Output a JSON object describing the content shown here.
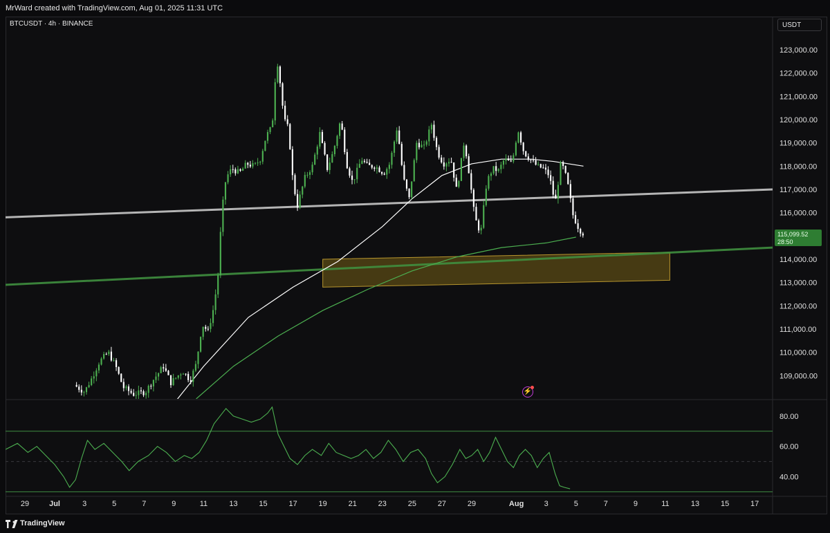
{
  "header": {
    "attribution": "MrWard created with TradingView.com, Aug 01, 2025 11:31 UTC"
  },
  "symbol": {
    "label": "BTCUSDT · 4h · BINANCE"
  },
  "currency": {
    "label": "USDT"
  },
  "last_price": {
    "value": "115,099.52",
    "countdown": "28:50"
  },
  "footer": {
    "brand": "TradingView"
  },
  "colors": {
    "up": "#4caf50",
    "down": "#ffffff",
    "trendline_white": "#c8c8c8",
    "trendline_green": "#3f8f3f",
    "zone_fill": "#5a4a14",
    "zone_border": "#b8962e",
    "rsi": "#4caf50"
  },
  "icons": {
    "indicator": "lightning-bolt-icon",
    "brand": "tradingview-logo-icon"
  },
  "chart_data": [
    {
      "type": "candlestick",
      "title": "BTCUSDT · 4h · BINANCE",
      "ylim": [
        108000,
        123800
      ],
      "y_ticks": [
        109000,
        110000,
        111000,
        112000,
        113000,
        114000,
        115000,
        116000,
        117000,
        118000,
        119000,
        120000,
        121000,
        122000,
        123000
      ],
      "y_tick_labels": [
        "109,000.00",
        "110,000.00",
        "111,000.00",
        "112,000.00",
        "113,000.00",
        "114,000.00",
        "115,000.00",
        "116,000.00",
        "117,000.00",
        "118,000.00",
        "119,000.00",
        "120,000.00",
        "121,000.00",
        "122,000.00",
        "123,000.00"
      ],
      "x_tick_labels": [
        "29",
        "Jul",
        "3",
        "5",
        "7",
        "9",
        "11",
        "13",
        "15",
        "17",
        "19",
        "21",
        "23",
        "25",
        "27",
        "29",
        "Aug",
        "3",
        "5",
        "7",
        "9",
        "11",
        "13",
        "15",
        "17"
      ],
      "x_tick_days": [
        -2,
        0,
        2,
        4,
        6,
        8,
        10,
        12,
        14,
        16,
        18,
        20,
        22,
        24,
        26,
        28,
        31,
        33,
        35,
        37,
        39,
        41,
        43,
        45,
        47
      ],
      "x_range_days": [
        -3.3,
        48.2
      ],
      "close_path": [
        [
          1.3,
          108600
        ],
        [
          2.0,
          108300
        ],
        [
          2.5,
          108900
        ],
        [
          3.0,
          109600
        ],
        [
          3.6,
          110000
        ],
        [
          4.1,
          109400
        ],
        [
          4.6,
          108500
        ],
        [
          5.3,
          108200
        ],
        [
          6.1,
          108300
        ],
        [
          6.6,
          108800
        ],
        [
          7.3,
          109400
        ],
        [
          7.8,
          108700
        ],
        [
          8.6,
          109200
        ],
        [
          9.1,
          108800
        ],
        [
          9.5,
          109500
        ],
        [
          9.9,
          111200
        ],
        [
          10.3,
          110900
        ],
        [
          10.7,
          112000
        ],
        [
          11.0,
          113500
        ],
        [
          11.2,
          115900
        ],
        [
          11.5,
          117500
        ],
        [
          11.9,
          117900
        ],
        [
          12.4,
          117700
        ],
        [
          12.9,
          118100
        ],
        [
          13.4,
          118000
        ],
        [
          13.8,
          118300
        ],
        [
          14.2,
          119300
        ],
        [
          14.6,
          119700
        ],
        [
          14.9,
          122700
        ],
        [
          15.1,
          121800
        ],
        [
          15.4,
          120000
        ],
        [
          15.7,
          119600
        ],
        [
          16.0,
          117300
        ],
        [
          16.3,
          116300
        ],
        [
          16.8,
          117500
        ],
        [
          17.3,
          118000
        ],
        [
          17.8,
          119400
        ],
        [
          18.3,
          117900
        ],
        [
          18.7,
          118600
        ],
        [
          19.2,
          120000
        ],
        [
          19.6,
          118100
        ],
        [
          20.0,
          117300
        ],
        [
          20.6,
          118300
        ],
        [
          21.0,
          118000
        ],
        [
          21.5,
          118000
        ],
        [
          22.1,
          117700
        ],
        [
          22.5,
          118100
        ],
        [
          23.0,
          119700
        ],
        [
          23.4,
          117500
        ],
        [
          23.8,
          116600
        ],
        [
          24.3,
          119000
        ],
        [
          24.8,
          118800
        ],
        [
          25.3,
          119800
        ],
        [
          25.7,
          118600
        ],
        [
          26.1,
          118100
        ],
        [
          26.6,
          118300
        ],
        [
          27.0,
          116900
        ],
        [
          27.5,
          119100
        ],
        [
          27.8,
          117800
        ],
        [
          28.2,
          115800
        ],
        [
          28.6,
          115100
        ],
        [
          29.0,
          117300
        ],
        [
          29.4,
          117900
        ],
        [
          29.8,
          117800
        ],
        [
          30.2,
          118300
        ],
        [
          30.7,
          118100
        ],
        [
          31.1,
          119600
        ],
        [
          31.5,
          118600
        ],
        [
          31.9,
          118300
        ],
        [
          32.4,
          118000
        ],
        [
          32.8,
          117900
        ],
        [
          33.2,
          117600
        ],
        [
          33.6,
          116400
        ],
        [
          34.0,
          118200
        ],
        [
          34.4,
          117400
        ],
        [
          34.8,
          115900
        ],
        [
          35.2,
          115300
        ],
        [
          35.5,
          115100
        ]
      ],
      "overlays": [
        {
          "name": "trendline",
          "color": "#c8c8c8",
          "from": [
            -3.3,
            115800
          ],
          "to": [
            48.2,
            117000
          ]
        },
        {
          "name": "trendline",
          "color": "#3f8f3f",
          "from": [
            -3.3,
            112900
          ],
          "to": [
            48.2,
            114500
          ]
        },
        {
          "name": "ma",
          "color": "#ffffff",
          "points": [
            [
              8.0,
              107800
            ],
            [
              10.0,
              109400
            ],
            [
              13.0,
              111500
            ],
            [
              16.0,
              112800
            ],
            [
              19.0,
              113900
            ],
            [
              22.0,
              115400
            ],
            [
              24.0,
              116600
            ],
            [
              26.0,
              117600
            ],
            [
              28.0,
              118100
            ],
            [
              30.0,
              118300
            ],
            [
              32.0,
              118300
            ],
            [
              33.5,
              118200
            ],
            [
              35.5,
              118000
            ]
          ]
        },
        {
          "name": "ma",
          "color": "#4caf50",
          "points": [
            [
              9.5,
              108000
            ],
            [
              12.0,
              109400
            ],
            [
              15.0,
              110700
            ],
            [
              18.0,
              111800
            ],
            [
              21.0,
              112700
            ],
            [
              24.0,
              113500
            ],
            [
              27.0,
              114100
            ],
            [
              30.0,
              114500
            ],
            [
              33.0,
              114700
            ],
            [
              35.0,
              114950
            ]
          ]
        }
      ],
      "zone": {
        "x": [
          18.0,
          41.3
        ],
        "y": [
          112800,
          114000
        ]
      }
    },
    {
      "type": "line",
      "title": "",
      "ylim": [
        27,
        90
      ],
      "y_ticks": [
        40,
        60,
        80
      ],
      "y_tick_labels": [
        "40.00",
        "60.00",
        "80.00"
      ],
      "bands": [
        30,
        50,
        70
      ],
      "series": [
        {
          "points": [
            [
              -3.3,
              58
            ],
            [
              -2.5,
              62
            ],
            [
              -1.8,
              56
            ],
            [
              -1.2,
              60
            ],
            [
              -0.6,
              54
            ],
            [
              0.0,
              48
            ],
            [
              0.6,
              40
            ],
            [
              1.0,
              33
            ],
            [
              1.4,
              38
            ],
            [
              1.8,
              52
            ],
            [
              2.2,
              64
            ],
            [
              2.7,
              58
            ],
            [
              3.3,
              62
            ],
            [
              3.9,
              56
            ],
            [
              4.5,
              50
            ],
            [
              5.0,
              44
            ],
            [
              5.6,
              50
            ],
            [
              6.3,
              54
            ],
            [
              6.9,
              60
            ],
            [
              7.5,
              56
            ],
            [
              8.1,
              50
            ],
            [
              8.7,
              54
            ],
            [
              9.2,
              52
            ],
            [
              9.7,
              56
            ],
            [
              10.2,
              64
            ],
            [
              10.7,
              75
            ],
            [
              11.1,
              80
            ],
            [
              11.5,
              85
            ],
            [
              12.0,
              80
            ],
            [
              12.6,
              78
            ],
            [
              13.2,
              76
            ],
            [
              13.8,
              78
            ],
            [
              14.3,
              82
            ],
            [
              14.6,
              86
            ],
            [
              15.0,
              68
            ],
            [
              15.4,
              60
            ],
            [
              15.8,
              52
            ],
            [
              16.3,
              48
            ],
            [
              16.8,
              54
            ],
            [
              17.3,
              58
            ],
            [
              17.9,
              54
            ],
            [
              18.4,
              62
            ],
            [
              18.9,
              56
            ],
            [
              19.4,
              54
            ],
            [
              19.9,
              52
            ],
            [
              20.4,
              54
            ],
            [
              20.9,
              58
            ],
            [
              21.4,
              52
            ],
            [
              21.9,
              56
            ],
            [
              22.4,
              64
            ],
            [
              22.9,
              58
            ],
            [
              23.4,
              50
            ],
            [
              23.9,
              56
            ],
            [
              24.4,
              58
            ],
            [
              24.9,
              52
            ],
            [
              25.3,
              42
            ],
            [
              25.7,
              36
            ],
            [
              26.2,
              40
            ],
            [
              26.7,
              48
            ],
            [
              27.2,
              58
            ],
            [
              27.6,
              52
            ],
            [
              28.0,
              54
            ],
            [
              28.4,
              58
            ],
            [
              28.8,
              50
            ],
            [
              29.2,
              56
            ],
            [
              29.6,
              66
            ],
            [
              30.0,
              58
            ],
            [
              30.4,
              50
            ],
            [
              30.8,
              46
            ],
            [
              31.2,
              54
            ],
            [
              31.6,
              58
            ],
            [
              32.0,
              54
            ],
            [
              32.4,
              46
            ],
            [
              32.8,
              52
            ],
            [
              33.2,
              56
            ],
            [
              33.6,
              42
            ],
            [
              33.9,
              34
            ],
            [
              34.2,
              33
            ],
            [
              34.6,
              32
            ]
          ]
        }
      ]
    }
  ]
}
